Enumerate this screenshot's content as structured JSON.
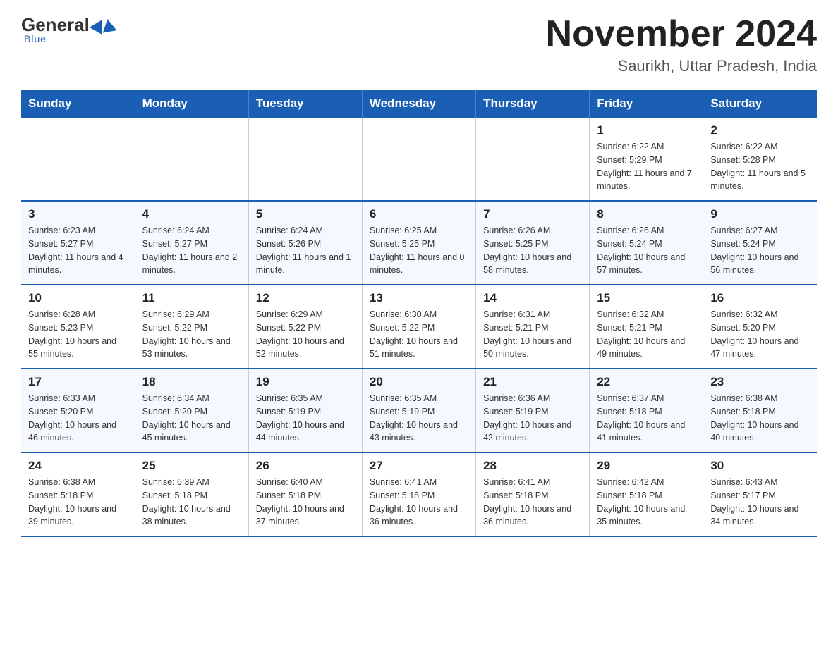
{
  "header": {
    "logo_general": "General",
    "logo_blue": "Blue",
    "month_title": "November 2024",
    "location": "Saurikh, Uttar Pradesh, India"
  },
  "weekdays": [
    "Sunday",
    "Monday",
    "Tuesday",
    "Wednesday",
    "Thursday",
    "Friday",
    "Saturday"
  ],
  "weeks": [
    {
      "days": [
        {
          "num": "",
          "info": ""
        },
        {
          "num": "",
          "info": ""
        },
        {
          "num": "",
          "info": ""
        },
        {
          "num": "",
          "info": ""
        },
        {
          "num": "",
          "info": ""
        },
        {
          "num": "1",
          "info": "Sunrise: 6:22 AM\nSunset: 5:29 PM\nDaylight: 11 hours and 7 minutes."
        },
        {
          "num": "2",
          "info": "Sunrise: 6:22 AM\nSunset: 5:28 PM\nDaylight: 11 hours and 5 minutes."
        }
      ]
    },
    {
      "days": [
        {
          "num": "3",
          "info": "Sunrise: 6:23 AM\nSunset: 5:27 PM\nDaylight: 11 hours and 4 minutes."
        },
        {
          "num": "4",
          "info": "Sunrise: 6:24 AM\nSunset: 5:27 PM\nDaylight: 11 hours and 2 minutes."
        },
        {
          "num": "5",
          "info": "Sunrise: 6:24 AM\nSunset: 5:26 PM\nDaylight: 11 hours and 1 minute."
        },
        {
          "num": "6",
          "info": "Sunrise: 6:25 AM\nSunset: 5:25 PM\nDaylight: 11 hours and 0 minutes."
        },
        {
          "num": "7",
          "info": "Sunrise: 6:26 AM\nSunset: 5:25 PM\nDaylight: 10 hours and 58 minutes."
        },
        {
          "num": "8",
          "info": "Sunrise: 6:26 AM\nSunset: 5:24 PM\nDaylight: 10 hours and 57 minutes."
        },
        {
          "num": "9",
          "info": "Sunrise: 6:27 AM\nSunset: 5:24 PM\nDaylight: 10 hours and 56 minutes."
        }
      ]
    },
    {
      "days": [
        {
          "num": "10",
          "info": "Sunrise: 6:28 AM\nSunset: 5:23 PM\nDaylight: 10 hours and 55 minutes."
        },
        {
          "num": "11",
          "info": "Sunrise: 6:29 AM\nSunset: 5:22 PM\nDaylight: 10 hours and 53 minutes."
        },
        {
          "num": "12",
          "info": "Sunrise: 6:29 AM\nSunset: 5:22 PM\nDaylight: 10 hours and 52 minutes."
        },
        {
          "num": "13",
          "info": "Sunrise: 6:30 AM\nSunset: 5:22 PM\nDaylight: 10 hours and 51 minutes."
        },
        {
          "num": "14",
          "info": "Sunrise: 6:31 AM\nSunset: 5:21 PM\nDaylight: 10 hours and 50 minutes."
        },
        {
          "num": "15",
          "info": "Sunrise: 6:32 AM\nSunset: 5:21 PM\nDaylight: 10 hours and 49 minutes."
        },
        {
          "num": "16",
          "info": "Sunrise: 6:32 AM\nSunset: 5:20 PM\nDaylight: 10 hours and 47 minutes."
        }
      ]
    },
    {
      "days": [
        {
          "num": "17",
          "info": "Sunrise: 6:33 AM\nSunset: 5:20 PM\nDaylight: 10 hours and 46 minutes."
        },
        {
          "num": "18",
          "info": "Sunrise: 6:34 AM\nSunset: 5:20 PM\nDaylight: 10 hours and 45 minutes."
        },
        {
          "num": "19",
          "info": "Sunrise: 6:35 AM\nSunset: 5:19 PM\nDaylight: 10 hours and 44 minutes."
        },
        {
          "num": "20",
          "info": "Sunrise: 6:35 AM\nSunset: 5:19 PM\nDaylight: 10 hours and 43 minutes."
        },
        {
          "num": "21",
          "info": "Sunrise: 6:36 AM\nSunset: 5:19 PM\nDaylight: 10 hours and 42 minutes."
        },
        {
          "num": "22",
          "info": "Sunrise: 6:37 AM\nSunset: 5:18 PM\nDaylight: 10 hours and 41 minutes."
        },
        {
          "num": "23",
          "info": "Sunrise: 6:38 AM\nSunset: 5:18 PM\nDaylight: 10 hours and 40 minutes."
        }
      ]
    },
    {
      "days": [
        {
          "num": "24",
          "info": "Sunrise: 6:38 AM\nSunset: 5:18 PM\nDaylight: 10 hours and 39 minutes."
        },
        {
          "num": "25",
          "info": "Sunrise: 6:39 AM\nSunset: 5:18 PM\nDaylight: 10 hours and 38 minutes."
        },
        {
          "num": "26",
          "info": "Sunrise: 6:40 AM\nSunset: 5:18 PM\nDaylight: 10 hours and 37 minutes."
        },
        {
          "num": "27",
          "info": "Sunrise: 6:41 AM\nSunset: 5:18 PM\nDaylight: 10 hours and 36 minutes."
        },
        {
          "num": "28",
          "info": "Sunrise: 6:41 AM\nSunset: 5:18 PM\nDaylight: 10 hours and 36 minutes."
        },
        {
          "num": "29",
          "info": "Sunrise: 6:42 AM\nSunset: 5:18 PM\nDaylight: 10 hours and 35 minutes."
        },
        {
          "num": "30",
          "info": "Sunrise: 6:43 AM\nSunset: 5:17 PM\nDaylight: 10 hours and 34 minutes."
        }
      ]
    }
  ]
}
